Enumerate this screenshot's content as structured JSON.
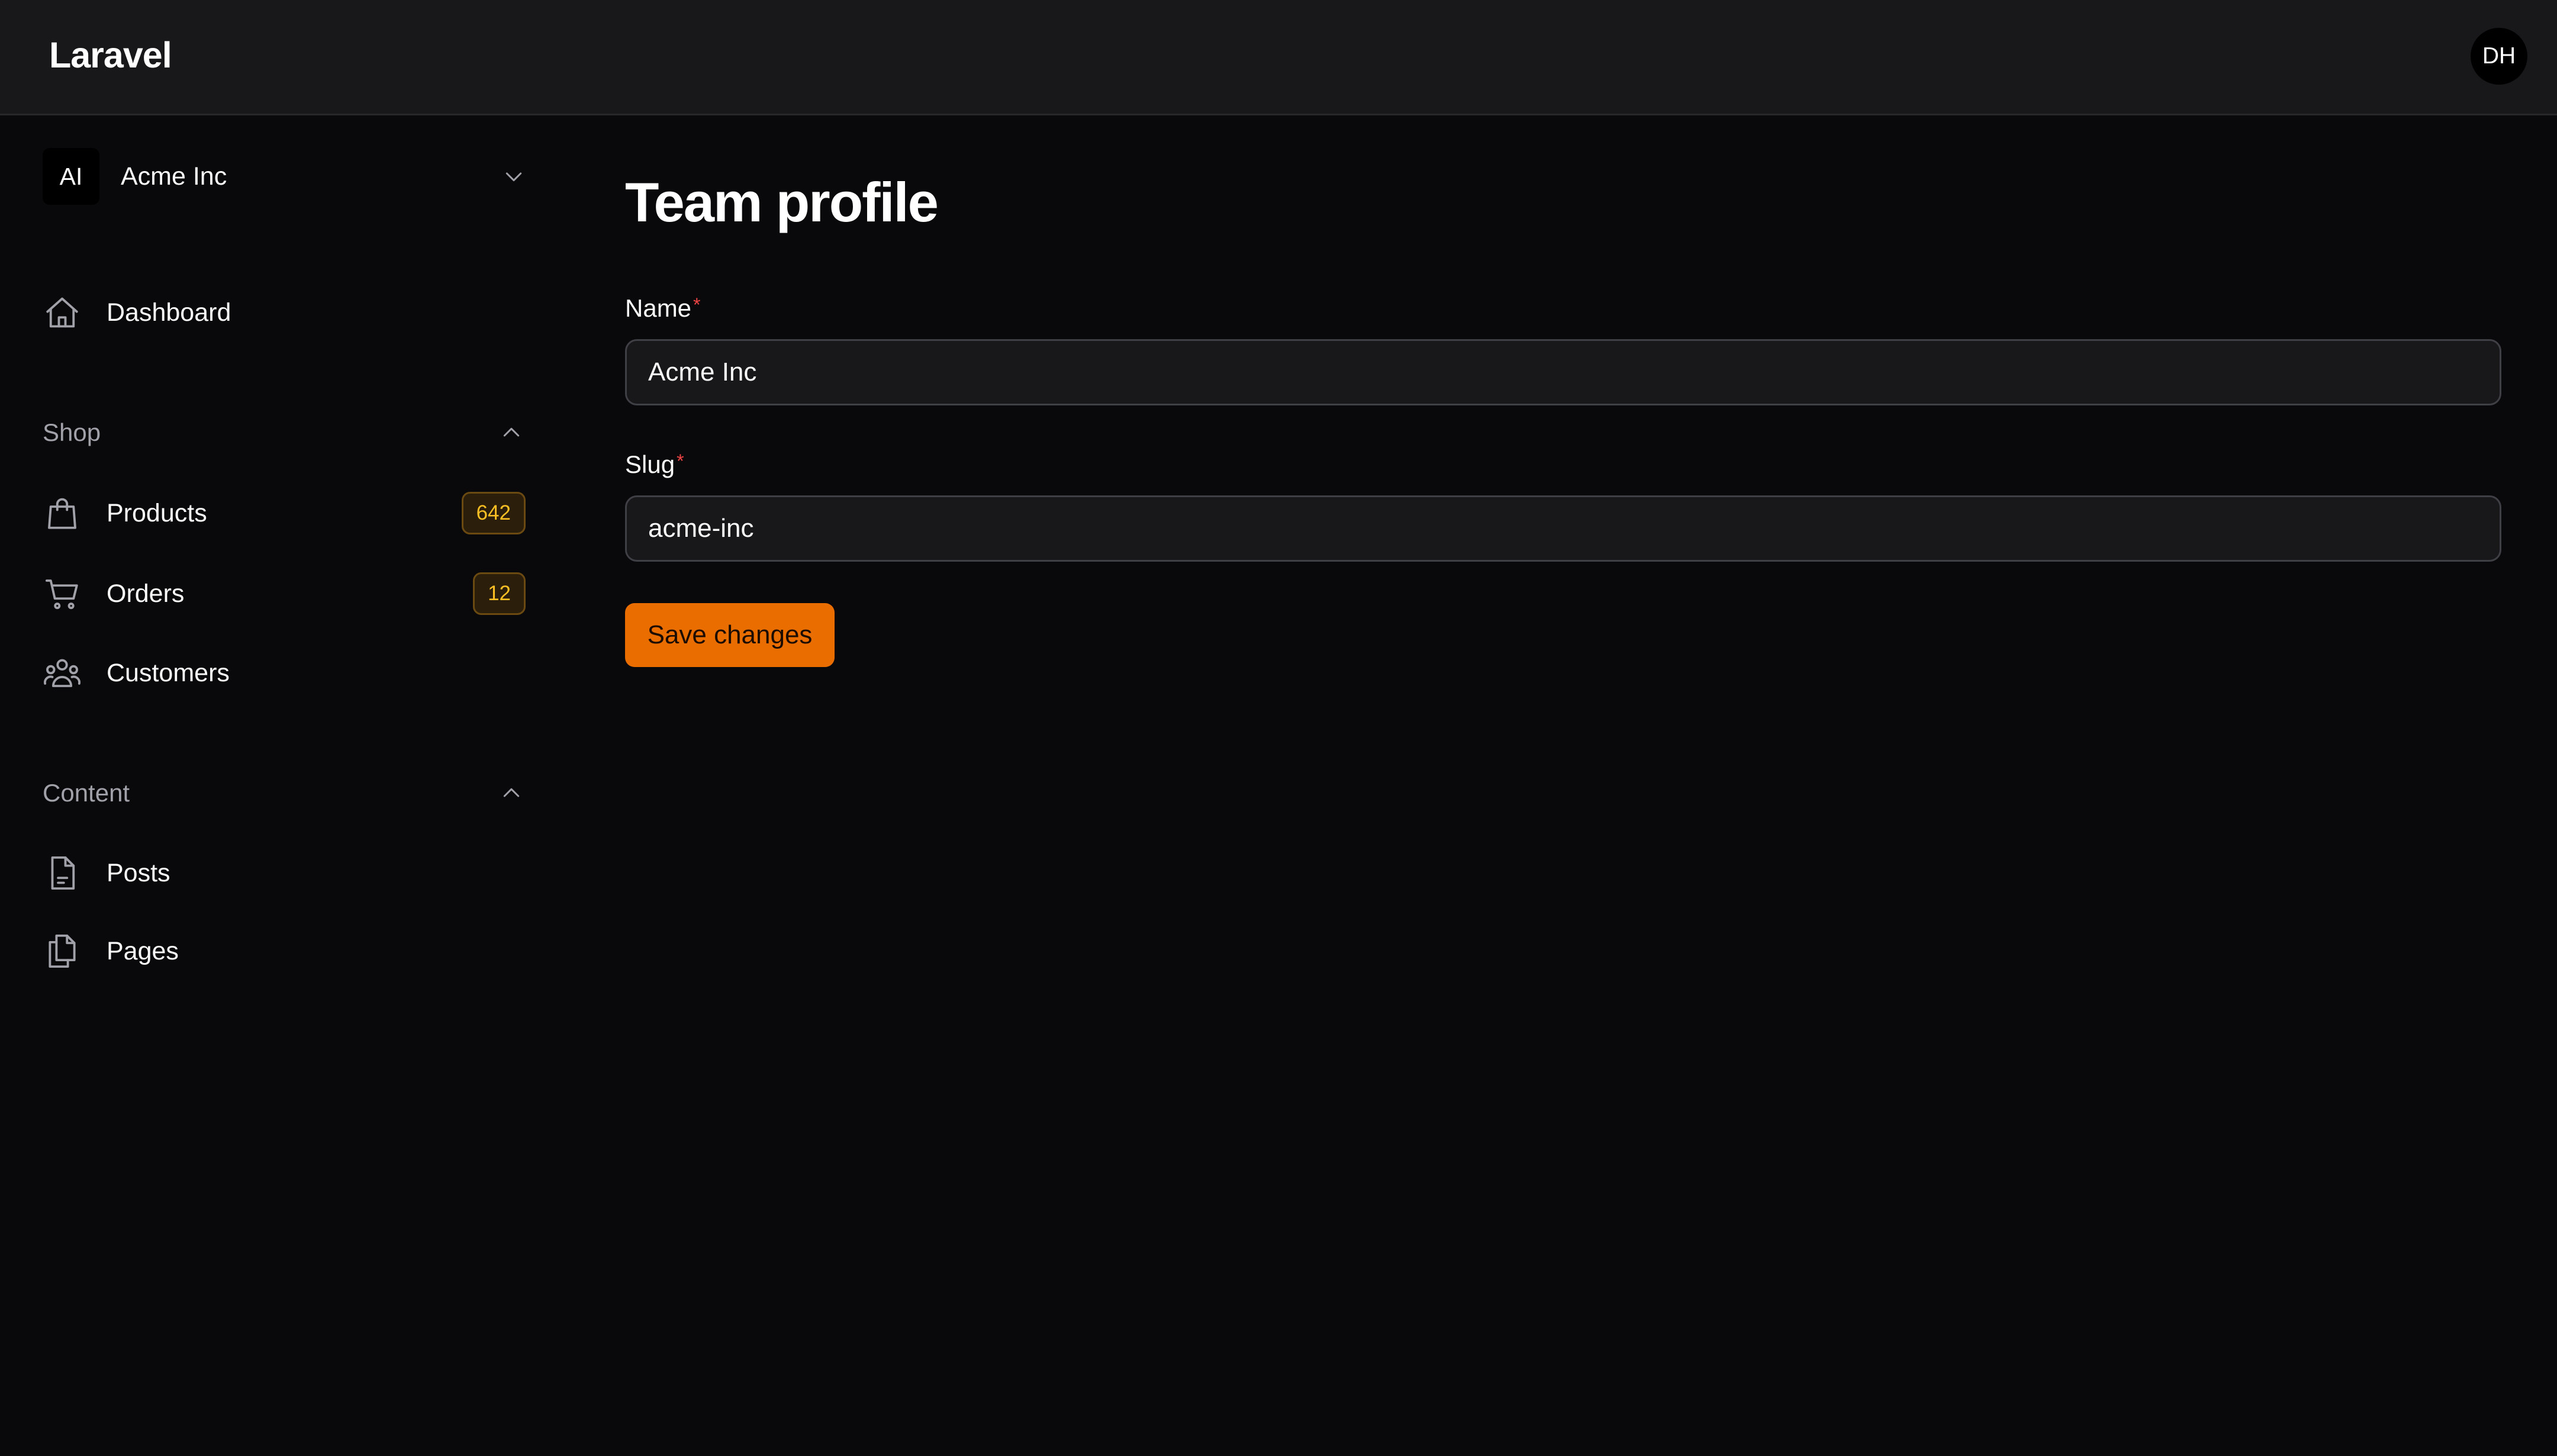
{
  "topbar": {
    "brand": "Laravel",
    "user_initials": "DH"
  },
  "sidebar": {
    "team": {
      "initials": "AI",
      "name": "Acme Inc"
    },
    "dashboard": {
      "label": "Dashboard",
      "icon": "home-icon"
    },
    "groups": [
      {
        "label": "Shop",
        "items": [
          {
            "label": "Products",
            "icon": "shopping-bag-icon",
            "badge": "642"
          },
          {
            "label": "Orders",
            "icon": "shopping-cart-icon",
            "badge": "12"
          },
          {
            "label": "Customers",
            "icon": "users-icon"
          }
        ]
      },
      {
        "label": "Content",
        "items": [
          {
            "label": "Posts",
            "icon": "document-icon"
          },
          {
            "label": "Pages",
            "icon": "documents-icon"
          }
        ]
      }
    ]
  },
  "main": {
    "title": "Team profile",
    "fields": {
      "name": {
        "label": "Name",
        "required_mark": "*",
        "value": "Acme Inc"
      },
      "slug": {
        "label": "Slug",
        "required_mark": "*",
        "value": "acme-inc"
      }
    },
    "save_label": "Save changes"
  },
  "colors": {
    "background": "#09090b",
    "topbar": "#18181b",
    "accent": "#ea6d00",
    "badge_text": "#fbbf24",
    "required": "#ef4444"
  }
}
